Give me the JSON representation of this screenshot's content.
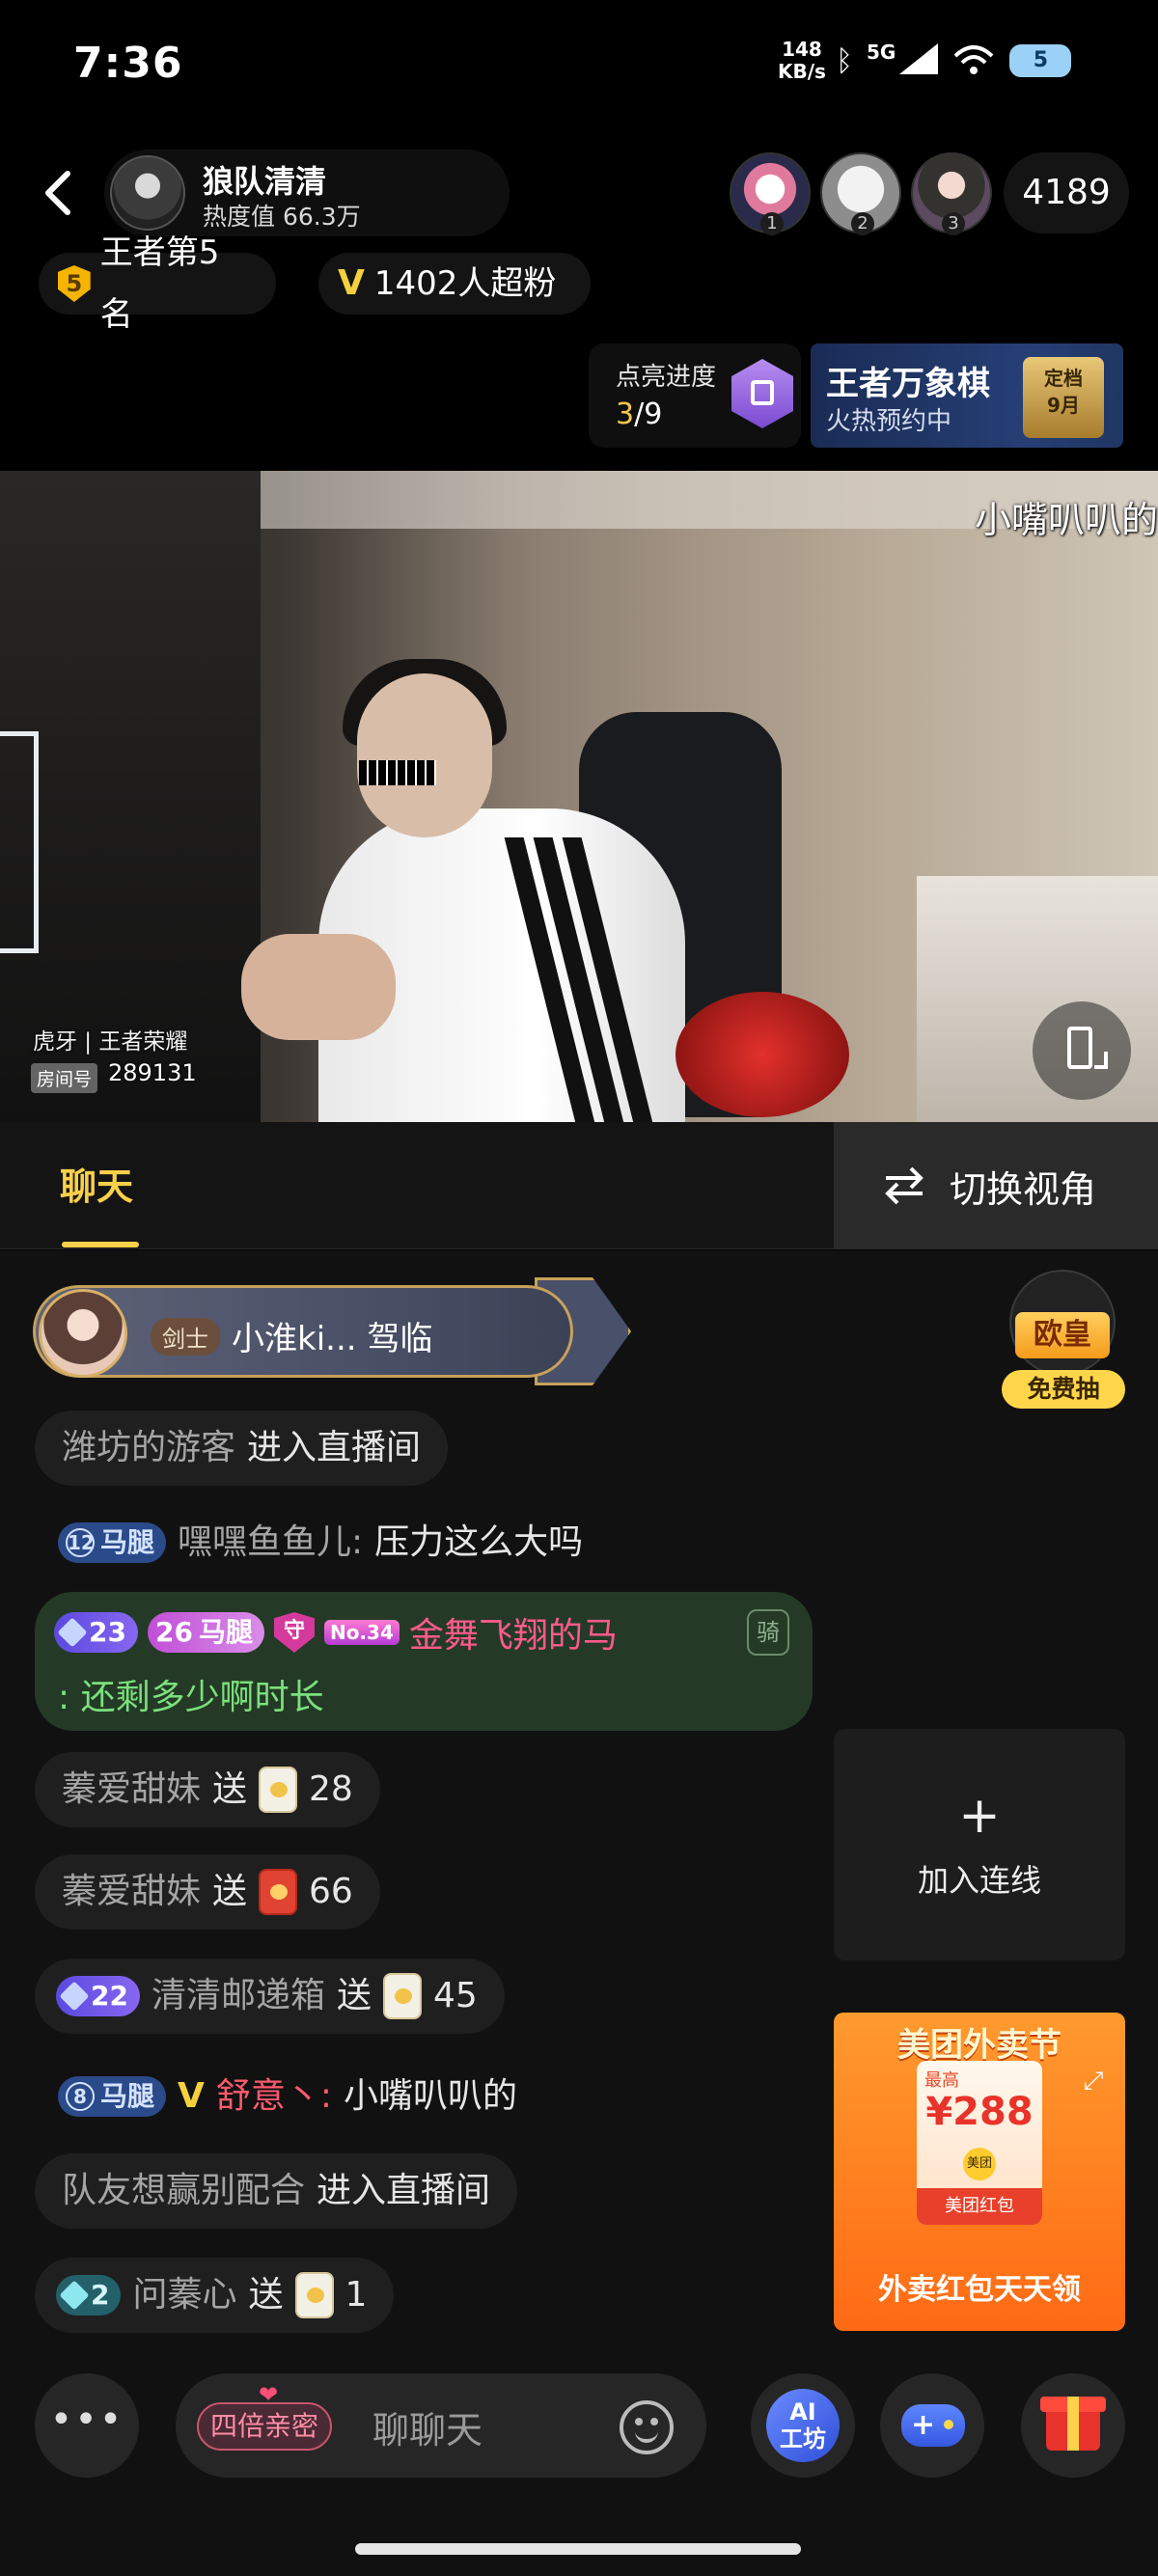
{
  "status_bar": {
    "time": "7:36",
    "net_speed_value": "148",
    "net_speed_unit": "KB/s",
    "network": "5G",
    "battery": "5"
  },
  "header": {
    "streamer_name": "狼队清清",
    "heat": "热度值 66.3万",
    "viewer_ranks": [
      "1",
      "2",
      "3"
    ],
    "viewer_count": "4189",
    "rank_badge_num": "5",
    "rank_badge": "王者第5名",
    "fans_badge": "1402人超粉"
  },
  "progress": {
    "label": "点亮进度",
    "current": "3",
    "total": "/9"
  },
  "game_banner": {
    "title": "王者万象棋",
    "subtitle": "火热预约中",
    "badge_line1": "定档",
    "badge_line2": "9月"
  },
  "video": {
    "caption": "小嘴叭叭的",
    "source": "虎牙 | 王者荣耀",
    "room_tag": "房间号",
    "room_number": "289131"
  },
  "tabs": {
    "chat": "聊天",
    "switch_view": "切换视角"
  },
  "chat": {
    "vip_entry": {
      "class_tag": "剑士",
      "text": "小淮ki... 驾临"
    },
    "lucky": {
      "title": "欧皇",
      "subtitle": "免费抽"
    },
    "messages": {
      "m1": {
        "user": "潍坊的游客",
        "action": "进入直播间"
      },
      "m2": {
        "level": "12",
        "tag": "马腿",
        "user": "嘿嘿鱼鱼儿:",
        "text": "压力这么大吗"
      },
      "m3": {
        "level": "23",
        "level2": "26",
        "tag": "马腿",
        "guard": "守",
        "no": "No.34",
        "user": "金舞飞翔的马",
        "text": ": 还剩多少啊时长",
        "ride": "骑"
      },
      "m4": {
        "user": "蓁爱甜妹",
        "action": "送",
        "count": "28"
      },
      "m5": {
        "user": "蓁爱甜妹",
        "action": "送",
        "count": "66"
      },
      "m6": {
        "level": "22",
        "user": "清清邮递箱",
        "action": "送",
        "count": "45"
      },
      "m7": {
        "level": "8",
        "tag": "马腿",
        "user": "舒意丶:",
        "text": "小嘴叭叭的"
      },
      "m8": {
        "user": "队友想赢别配合",
        "action": "进入直播间"
      },
      "m9": {
        "level": "2",
        "user": "问蓁心",
        "action": "送",
        "count": "1"
      }
    }
  },
  "connect": {
    "plus": "+",
    "label": "加入连线"
  },
  "ad": {
    "title": "美团外卖节",
    "card_top": "最高",
    "amount": "¥288",
    "logo": "美团",
    "card_label": "美团红包",
    "bottom": "外卖红包天天领"
  },
  "bottom_bar": {
    "more": "•••",
    "input_tag": "四倍亲密",
    "input_placeholder": "聊聊天",
    "ai_label_1": "AI",
    "ai_label_2": "工坊"
  }
}
